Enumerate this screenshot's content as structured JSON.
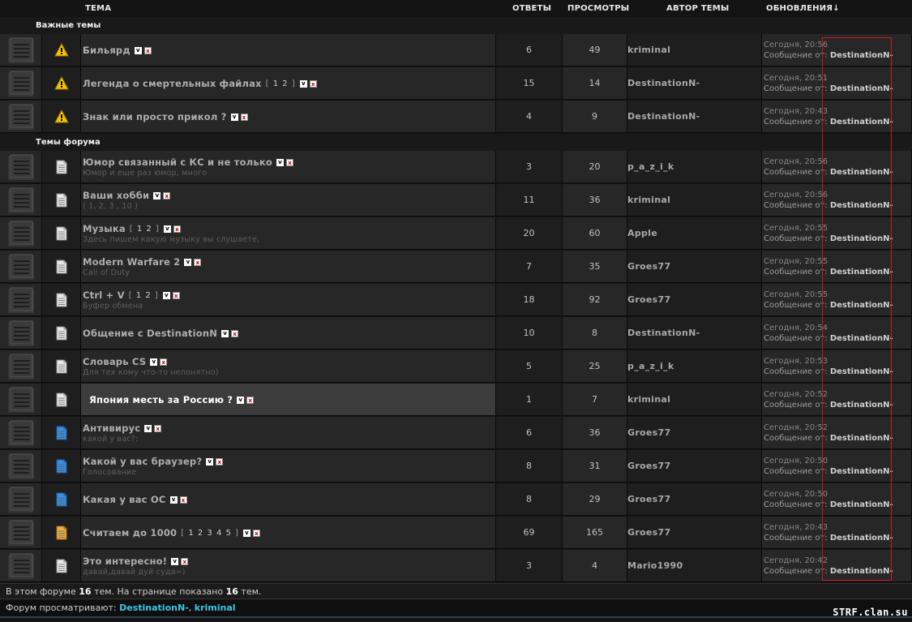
{
  "columns": {
    "topic": "ТЕМА",
    "replies": "ОТВЕТЫ",
    "views": "ПРОСМОТРЫ",
    "author": "АВТОР ТЕМЫ",
    "updates": "ОБНОВЛЕНИЯ↓"
  },
  "sections": {
    "important": "Важные темы",
    "forum": "Темы форума"
  },
  "labels": {
    "message_from": "Сообщение от:",
    "vote_icon": "v",
    "delete_icon": "x"
  },
  "topics": [
    {
      "section": "important",
      "status": "important",
      "title": "Бильярд",
      "desc": "",
      "pages": "",
      "replies": "6",
      "views": "49",
      "author": "kriminal",
      "updated": "Сегодня, 20:56",
      "last_by": "DestinationN-"
    },
    {
      "section": "important",
      "status": "important",
      "title": "Легенда о смертельных файлах",
      "desc": "",
      "pages": "1 2",
      "replies": "15",
      "views": "14",
      "author": "DestinationN-",
      "updated": "Сегодня, 20:51",
      "last_by": "DestinationN-"
    },
    {
      "section": "important",
      "status": "important",
      "title": "Знак или просто прикол ?",
      "desc": "",
      "pages": "",
      "replies": "4",
      "views": "9",
      "author": "DestinationN-",
      "updated": "Сегодня, 20:43",
      "last_by": "DestinationN-"
    },
    {
      "section": "forum",
      "status": "normal",
      "title": "Юмор связанный с КС и не только",
      "desc": "Юмор и еще раз юмор, много",
      "pages": "",
      "replies": "3",
      "views": "20",
      "author": "p_a_z_i_k",
      "updated": "Сегодня, 20:56",
      "last_by": "DestinationN-"
    },
    {
      "section": "forum",
      "status": "normal",
      "title": "Ваши хобби",
      "desc": "( 1, 2, 3 , 10 )",
      "pages": "",
      "replies": "11",
      "views": "36",
      "author": "kriminal",
      "updated": "Сегодня, 20:56",
      "last_by": "DestinationN-"
    },
    {
      "section": "forum",
      "status": "normal",
      "title": "Музыка",
      "desc": "Здесь пишем какую музыку вы слушаете,",
      "pages": "1 2",
      "replies": "20",
      "views": "60",
      "author": "Apple",
      "updated": "Сегодня, 20:55",
      "last_by": "DestinationN-"
    },
    {
      "section": "forum",
      "status": "normal",
      "title": "Modern Warfare 2",
      "desc": "Call of Duty",
      "pages": "",
      "replies": "7",
      "views": "35",
      "author": "Groes77",
      "updated": "Сегодня, 20:55",
      "last_by": "DestinationN-"
    },
    {
      "section": "forum",
      "status": "normal",
      "title": "Ctrl + V",
      "desc": "Буфер обмена",
      "pages": "1 2",
      "replies": "18",
      "views": "92",
      "author": "Groes77",
      "updated": "Сегодня, 20:55",
      "last_by": "DestinationN-"
    },
    {
      "section": "forum",
      "status": "normal",
      "title": "Общение с DestinationN",
      "desc": "",
      "pages": "",
      "replies": "10",
      "views": "8",
      "author": "DestinationN-",
      "updated": "Сегодня, 20:54",
      "last_by": "DestinationN-"
    },
    {
      "section": "forum",
      "status": "normal",
      "title": "Словарь CS",
      "desc": "Для тех кому что-то непонятно)",
      "pages": "",
      "replies": "5",
      "views": "25",
      "author": "p_a_z_i_k",
      "updated": "Сегодня, 20:53",
      "last_by": "DestinationN-"
    },
    {
      "section": "forum",
      "status": "normal",
      "title": "Япония месть за Россию ?",
      "desc": "",
      "pages": "",
      "replies": "1",
      "views": "7",
      "author": "kriminal",
      "updated": "Сегодня, 20:52",
      "last_by": "DestinationN-",
      "highlight": true
    },
    {
      "section": "forum",
      "status": "poll",
      "title": "Антивирус",
      "desc": "какой у вас?:",
      "pages": "",
      "replies": "6",
      "views": "36",
      "author": "Groes77",
      "updated": "Сегодня, 20:52",
      "last_by": "DestinationN-"
    },
    {
      "section": "forum",
      "status": "poll",
      "title": "Какой у вас браузер?",
      "desc": "Голосование",
      "pages": "",
      "replies": "8",
      "views": "31",
      "author": "Groes77",
      "updated": "Сегодня, 20:50",
      "last_by": "DestinationN-"
    },
    {
      "section": "forum",
      "status": "poll",
      "title": "Какая у вас ОС",
      "desc": "",
      "pages": "",
      "replies": "8",
      "views": "29",
      "author": "Groes77",
      "updated": "Сегодня, 20:50",
      "last_by": "DestinationN-"
    },
    {
      "section": "forum",
      "status": "hot",
      "title": "Считаем до 1000",
      "desc": "",
      "pages": "1 2 3 4 5",
      "replies": "69",
      "views": "165",
      "author": "Groes77",
      "updated": "Сегодня, 20:43",
      "last_by": "DestinationN-"
    },
    {
      "section": "forum",
      "status": "normal",
      "title": "Это интересно!",
      "desc": "давай,давай дуй суда=)",
      "pages": "",
      "replies": "3",
      "views": "4",
      "author": "Mario1990",
      "updated": "Сегодня, 20:42",
      "last_by": "DestinationN-"
    }
  ],
  "footer": {
    "stats_prefix": "В этом форуме",
    "topic_count": "16",
    "stats_mid": "тем. На странице показано",
    "shown_count": "16",
    "stats_suffix": "тем.",
    "viewers_label": "Форум просматривают:",
    "viewers": [
      "DestinationN-",
      "kriminal"
    ],
    "viewers_sep": ", "
  },
  "watermark": "STRF.clan.su",
  "colors": {
    "background": "#141414",
    "row": "#272727",
    "highlight_row": "#3c3c3c",
    "user_link": "#37c7e6",
    "selection_box": "#d01818"
  }
}
